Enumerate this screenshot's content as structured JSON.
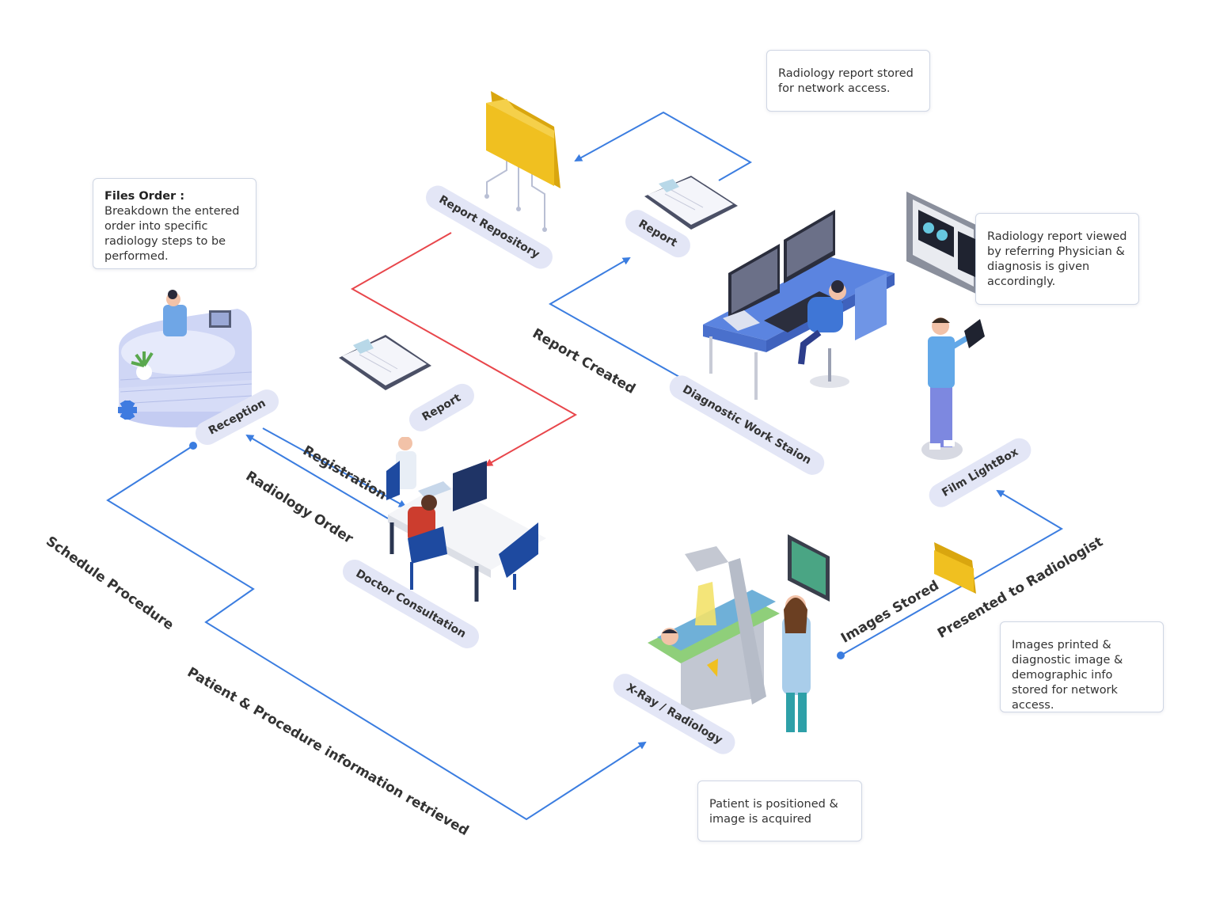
{
  "notes": {
    "files_order_title": "Files Order :",
    "files_order_body": "Breakdown the entered order into specific radiology steps to be performed.",
    "report_stored": "Radiology report  stored for network access.",
    "report_viewed": "Radiology report viewed by referring Physician & diagnosis is given accordingly.",
    "images_printed": "Images printed & diagnostic image & demographic info stored for network access.",
    "patient_positioned": "Patient is positioned & image is acquired"
  },
  "stations": {
    "reception": "Reception",
    "report_repository": "Report Repository",
    "report_top": "Report",
    "report_mid": "Report",
    "doctor_consultation": "Doctor Consultation",
    "diagnostic_work_station": "Diagnostic Work Staion",
    "film_lightbox": "Film LightBox",
    "xray_radiology": "X-Ray / Radiology"
  },
  "flows": {
    "schedule_procedure": "Schedule Procedure",
    "registration": "Registration",
    "radiology_order": "Radiology Order",
    "report_created": "Report Created",
    "patient_procedure": "Patient & Procedure information retrieved",
    "images_stored": "Images Stored",
    "presented_to_radiologist": "Presented to Radiologist"
  },
  "colors": {
    "flow_blue": "#3b7de0",
    "flow_red": "#e8464b",
    "pill_bg": "#e3e6f6",
    "folder_yellow": "#f0c020",
    "desk_blue": "#5b84e0"
  },
  "icons": [
    "reception-desk-icon",
    "folder-icon",
    "clipboard-icon",
    "workstation-icon",
    "doctor-icon",
    "xray-machine-icon",
    "consultation-table-icon"
  ]
}
